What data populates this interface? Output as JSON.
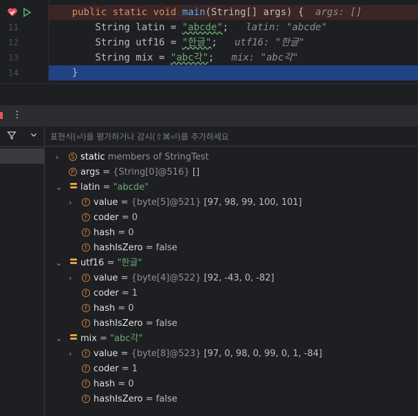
{
  "editor": {
    "lines": [
      {
        "num": "",
        "parts": [
          [
            "kw",
            "public "
          ],
          [
            "kw",
            "static "
          ],
          [
            "kw",
            "void "
          ],
          [
            "fn",
            "main"
          ],
          [
            "",
            "(String[] args) {  "
          ],
          [
            "inl",
            "args: []"
          ]
        ]
      },
      {
        "num": "11",
        "parts": [
          [
            "",
            "    String latin = "
          ],
          [
            "str",
            "\"abcde\""
          ],
          [
            "",
            ";   "
          ],
          [
            "inl",
            "latin: \"abcde\""
          ]
        ]
      },
      {
        "num": "12",
        "parts": [
          [
            "",
            "    String utf16 = "
          ],
          [
            "str",
            "\"한글\""
          ],
          [
            "",
            ";   "
          ],
          [
            "inl",
            "utf16: \"한글\""
          ]
        ]
      },
      {
        "num": "13",
        "parts": [
          [
            "",
            "    String mix = "
          ],
          [
            "str",
            "\"abc각\""
          ],
          [
            "",
            ";   "
          ],
          [
            "inl",
            "mix: \"abc각\""
          ]
        ]
      },
      {
        "num": "14",
        "parts": [
          [
            "",
            "}"
          ]
        ]
      }
    ]
  },
  "debugger": {
    "eval_placeholder": "표현식(⏎)을 평가하거나 감시(⇧⌘⏎)를 추가하세요",
    "toolbar_more": "⋮",
    "filter_icon": "filter-icon"
  },
  "variables": {
    "static_row": {
      "kw": "static",
      "rest": " members of StringTest"
    },
    "args_row": {
      "name": "args",
      "eq": " = ",
      "type": "{String[0]@516}",
      "val": " []"
    },
    "latin": {
      "name": "latin",
      "eq": " = ",
      "val": "\"abcde\""
    },
    "latin_value": {
      "name": "value",
      "eq": " = ",
      "type": "{byte[5]@521}",
      "val": " [97, 98, 99, 100, 101]"
    },
    "latin_coder": {
      "name": "coder",
      "eq": " = ",
      "val": "0"
    },
    "latin_hash": {
      "name": "hash",
      "eq": " = ",
      "val": "0"
    },
    "latin_hz": {
      "name": "hashIsZero",
      "eq": " = ",
      "val": "false"
    },
    "utf16": {
      "name": "utf16",
      "eq": " = ",
      "val": "\"한글\""
    },
    "utf16_value": {
      "name": "value",
      "eq": " = ",
      "type": "{byte[4]@522}",
      "val": " [92, -43, 0, -82]"
    },
    "utf16_coder": {
      "name": "coder",
      "eq": " = ",
      "val": "1"
    },
    "utf16_hash": {
      "name": "hash",
      "eq": " = ",
      "val": "0"
    },
    "utf16_hz": {
      "name": "hashIsZero",
      "eq": " = ",
      "val": "false"
    },
    "mix": {
      "name": "mix",
      "eq": " = ",
      "val": "\"abc각\""
    },
    "mix_value": {
      "name": "value",
      "eq": " = ",
      "type": "{byte[8]@523}",
      "val": " [97, 0, 98, 0, 99, 0, 1, -84]"
    },
    "mix_coder": {
      "name": "coder",
      "eq": " = ",
      "val": "1"
    },
    "mix_hash": {
      "name": "hash",
      "eq": " = ",
      "val": "0"
    },
    "mix_hz": {
      "name": "hashIsZero",
      "eq": " = ",
      "val": "false"
    }
  },
  "colors": {
    "exec_line": "#3b2525",
    "selected_line": "#214283",
    "field_badge": "#c77d42",
    "string_value": "#6aab73"
  }
}
